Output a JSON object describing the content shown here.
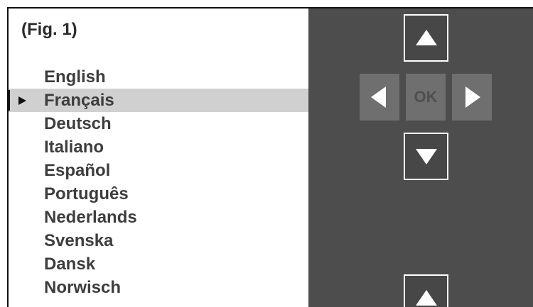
{
  "figure_label": "(Fig. 1)",
  "languages": [
    {
      "label": "English"
    },
    {
      "label": "Français",
      "selected": true
    },
    {
      "label": "Deutsch"
    },
    {
      "label": "Italiano"
    },
    {
      "label": "Español"
    },
    {
      "label": "Português"
    },
    {
      "label": "Nederlands"
    },
    {
      "label": "Svenska"
    },
    {
      "label": "Dansk"
    },
    {
      "label": "Norwisch"
    }
  ],
  "nav": {
    "ok_label": "OK",
    "up_icon": "triangle-up-icon",
    "down_icon": "triangle-down-icon",
    "left_icon": "triangle-left-icon",
    "right_icon": "triangle-right-icon"
  },
  "colors": {
    "panel": "#4d4d4d",
    "selected_row": "#d0d0d0",
    "text": "#3d3d3d",
    "button_filled": "#6f6f6f"
  }
}
